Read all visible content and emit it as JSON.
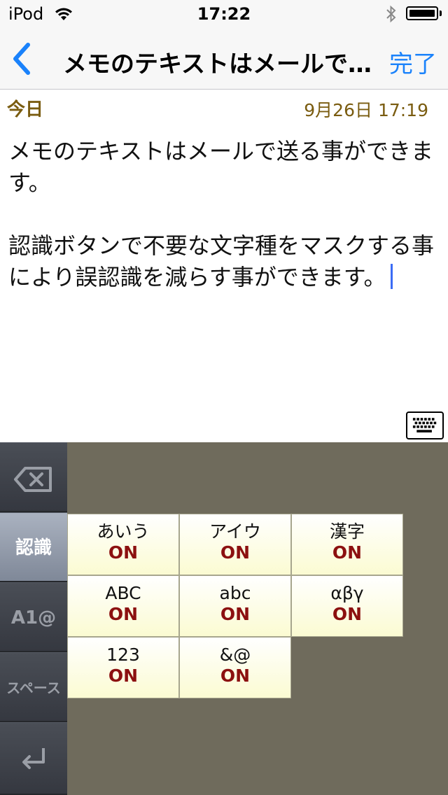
{
  "status_bar": {
    "carrier": "iPod",
    "time": "17:22",
    "icons": [
      "wifi-icon",
      "bluetooth-icon",
      "battery-icon"
    ]
  },
  "nav": {
    "title": "メモのテキストはメールで…",
    "done_label": "完了",
    "back_icon": "chevron-left-icon"
  },
  "note": {
    "day_label": "今日",
    "date": "9月26日 17:19",
    "paragraph1": "メモのテキストはメールで送る事ができます。",
    "paragraph2": "認識ボタンで不要な文字種をマスクする事により誤認識を減らす事ができます。"
  },
  "side_keys": {
    "delete_icon": "backspace-icon",
    "recognize_label": "認識",
    "alnum_label": "A1@",
    "space_label": "スペース",
    "return_icon": "return-icon"
  },
  "char_types": [
    {
      "name": "あいう",
      "state": "ON"
    },
    {
      "name": "アイウ",
      "state": "ON"
    },
    {
      "name": "漢字",
      "state": "ON"
    },
    {
      "name": "ABC",
      "state": "ON"
    },
    {
      "name": "abc",
      "state": "ON"
    },
    {
      "name": "αβγ",
      "state": "ON"
    },
    {
      "name": "123",
      "state": "ON"
    },
    {
      "name": "&@",
      "state": "ON"
    }
  ],
  "colors": {
    "accent": "#1a82fb",
    "meta_text": "#7a5c10",
    "state_on": "#8c1010",
    "keyboard_bg": "#6f6b5c"
  }
}
